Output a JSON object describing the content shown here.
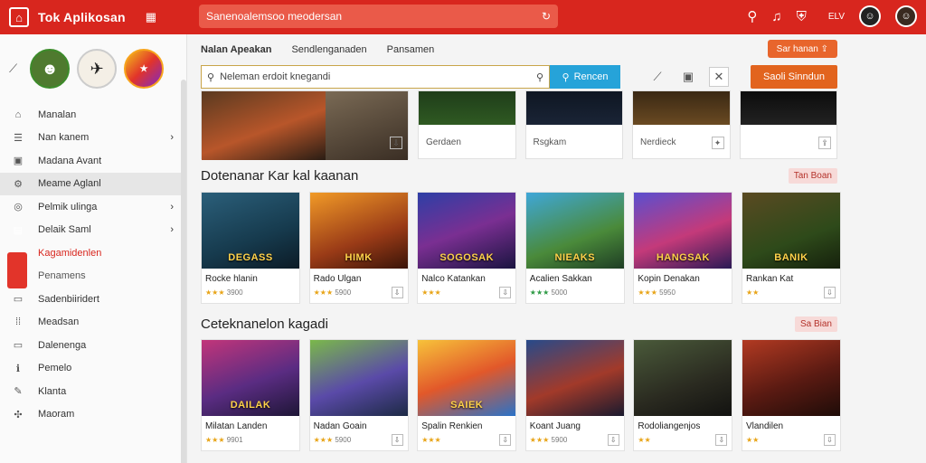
{
  "app": {
    "title": "Tok Aplikosan"
  },
  "topbar": {
    "search_placeholder": "Sanenoalemsoo meodersan",
    "profile_label": "ELV"
  },
  "sidebar": {
    "items": [
      {
        "label": "Manalan",
        "icon": "home-icon"
      },
      {
        "label": "Nan kanem",
        "icon": "list-icon"
      },
      {
        "label": "Madana Avant",
        "icon": "grid-icon"
      },
      {
        "label": "Meame Aglanl",
        "icon": "puzzle-icon"
      },
      {
        "label": "Pelmik ulinga",
        "icon": "circle-icon"
      },
      {
        "label": "Delaik Saml",
        "icon": "bag-icon"
      },
      {
        "label": "Kagamidenlen",
        "icon": "star-icon"
      },
      {
        "label": "Penamens",
        "icon": ""
      },
      {
        "label": "Sadenbiiridert",
        "icon": "box-icon"
      },
      {
        "label": "Meadsan",
        "icon": "dots-icon"
      },
      {
        "label": "Dalenenga",
        "icon": "doc-icon"
      },
      {
        "label": "Pemelo",
        "icon": "info-icon"
      },
      {
        "label": "Klanta",
        "icon": "pencil-icon"
      },
      {
        "label": "Maoram",
        "icon": "settings-icon"
      }
    ]
  },
  "main": {
    "tabs": [
      "Nalan Apeakan",
      "Sendlenganaden",
      "Pansamen"
    ],
    "top_button": "Sar hanan",
    "search_placeholder": "Neleman erdoit knegandi",
    "search_button": "Rencen",
    "action_button": "Saoli Sinndun",
    "row0_labels": [
      "Gerdaen",
      "Rsgkam",
      "Nerdieck",
      "",
      ""
    ],
    "section1": {
      "title": "Dotenanar Kar kal kaanan",
      "badge": "Tan Boan",
      "cards": [
        {
          "title": "Rocke hlanin",
          "art": "DEGASS",
          "rating": "3900"
        },
        {
          "title": "Rado Ulgan",
          "art": "HIMK",
          "rating": "5900"
        },
        {
          "title": "Nalco Katankan",
          "art": "SOGOSAK",
          "rating": ""
        },
        {
          "title": "Acalien Sakkan",
          "art": "NIEAKS",
          "rating": "5000"
        },
        {
          "title": "Kopin Denakan",
          "art": "HANGSAK",
          "rating": "5950"
        },
        {
          "title": "Rankan Kat",
          "art": "BANIK",
          "rating": ""
        }
      ]
    },
    "section2": {
      "title": "Ceteknanelon kagadi",
      "badge": "Sa Bian",
      "cards": [
        {
          "title": "Milatan Landen",
          "art": "DAILAK",
          "rating": "9901"
        },
        {
          "title": "Nadan Goain",
          "art": "",
          "rating": "5900"
        },
        {
          "title": "Spalin Renkien",
          "art": "SAIEK",
          "rating": ""
        },
        {
          "title": "Koant Juang",
          "art": "",
          "rating": "5900"
        },
        {
          "title": "Rodoliangenjos",
          "art": "",
          "rating": ""
        },
        {
          "title": "Vlandilen",
          "art": "",
          "rating": ""
        }
      ]
    }
  }
}
